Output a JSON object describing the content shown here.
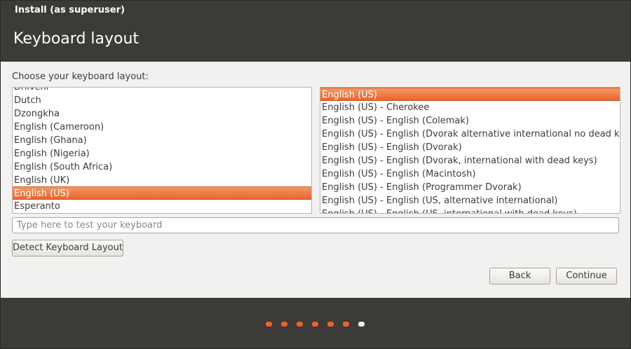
{
  "window": {
    "title": "Install (as superuser)"
  },
  "page": {
    "title": "Keyboard layout",
    "prompt": "Choose your keyboard layout:"
  },
  "layouts": {
    "partial_top": "Dhivehi",
    "items": [
      "Dutch",
      "Dzongkha",
      "English (Cameroon)",
      "English (Ghana)",
      "English (Nigeria)",
      "English (South Africa)",
      "English (UK)",
      "English (US)",
      "Esperanto"
    ],
    "selected": "English (US)"
  },
  "variants": {
    "items": [
      "English (US)",
      "English (US) - Cherokee",
      "English (US) - English (Colemak)",
      "English (US) - English (Dvorak alternative international no dead keys)",
      "English (US) - English (Dvorak)",
      "English (US) - English (Dvorak, international with dead keys)",
      "English (US) - English (Macintosh)",
      "English (US) - English (Programmer Dvorak)",
      "English (US) - English (US, alternative international)"
    ],
    "partial_bottom": "English (US) - English (US, international with dead keys)",
    "selected": "English (US)"
  },
  "test_input": {
    "placeholder": "Type here to test your keyboard",
    "value": ""
  },
  "buttons": {
    "detect": "Detect Keyboard Layout",
    "back": "Back",
    "continue": "Continue"
  },
  "progress": {
    "total_steps": 7,
    "current_step": 7
  },
  "colors": {
    "accent": "#e9662e",
    "header_bg": "#3c3b37",
    "window_bg": "#f2f1f0"
  }
}
